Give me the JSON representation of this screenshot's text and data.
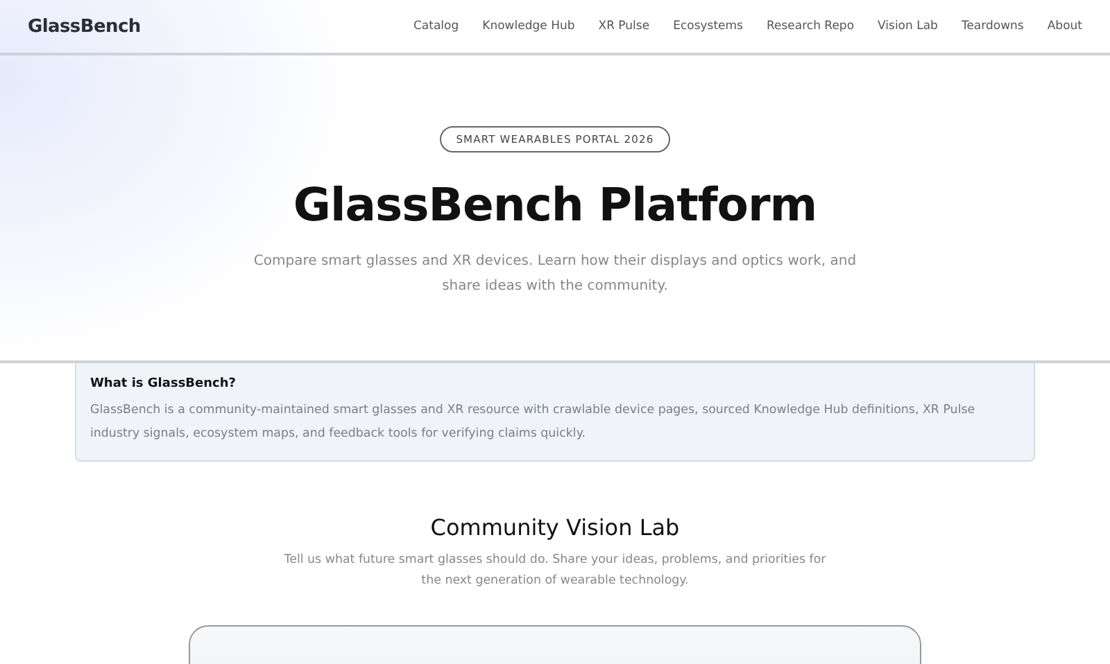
{
  "header": {
    "logo": "GlassBench",
    "nav": [
      "Catalog",
      "Knowledge Hub",
      "XR Pulse",
      "Ecosystems",
      "Research Repo",
      "Vision Lab",
      "Teardowns",
      "About"
    ]
  },
  "hero": {
    "badge": "SMART WEARABLES PORTAL 2026",
    "title": "GlassBench Platform",
    "subtitle": "Compare smart glasses and XR devices. Learn how their displays and optics work, and share ideas with the community."
  },
  "info": {
    "title": "What is GlassBench?",
    "text": "GlassBench is a community-maintained smart glasses and XR resource with crawlable device pages, sourced Knowledge Hub definitions, XR Pulse industry signals, ecosystem maps, and feedback tools for verifying claims quickly."
  },
  "section": {
    "title": "Community Vision Lab",
    "text": "Tell us what future smart glasses should do. Share your ideas, problems, and priorities for the next generation of wearable technology."
  }
}
